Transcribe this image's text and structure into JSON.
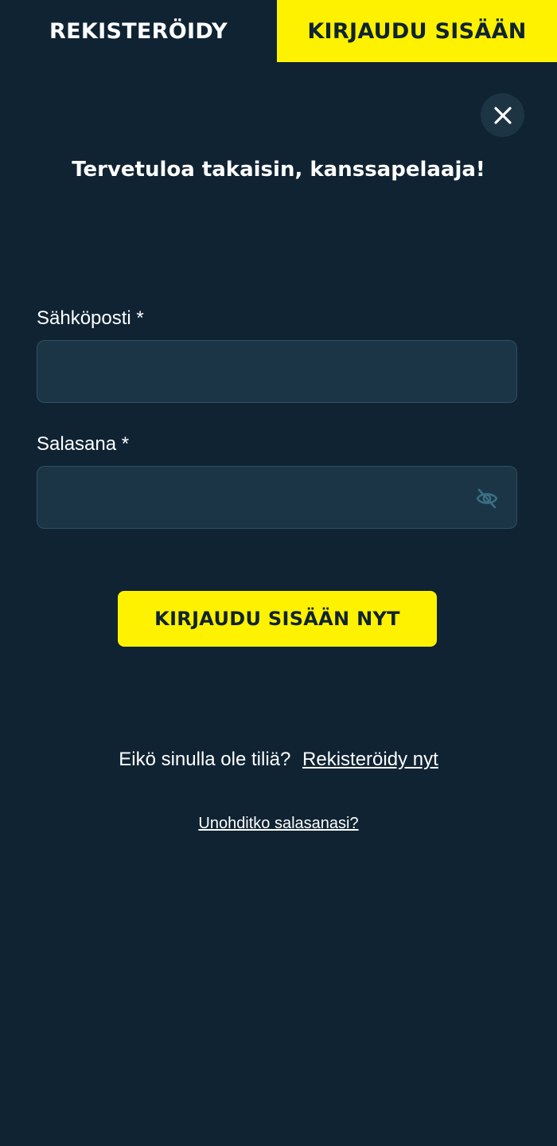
{
  "tabs": {
    "register_label": "REKISTERÖIDY",
    "login_label": "KIRJAUDU SISÄÄN"
  },
  "close_icon": "close-icon",
  "heading": "Tervetuloa takaisin, kanssapelaaja!",
  "form": {
    "email_label": "Sähköposti *",
    "email_value": "",
    "password_label": "Salasana *",
    "password_value": "",
    "password_toggle_icon": "eye-off-icon",
    "submit_label": "KIRJAUDU SISÄÄN NYT"
  },
  "footer": {
    "no_account_text": "Eikö sinulla ole tiliä?",
    "register_link": "Rekisteröidy nyt",
    "forgot_password_link": "Unohditko salasanasi?"
  },
  "colors": {
    "background": "#0f2333",
    "accent": "#fff200",
    "input_background": "#1c3546",
    "input_border": "#2e4f63"
  }
}
